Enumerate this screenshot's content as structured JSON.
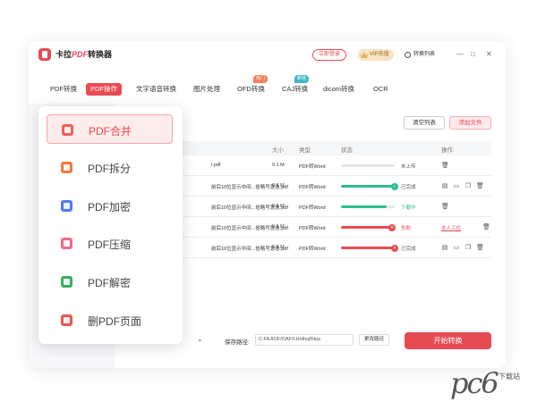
{
  "app": {
    "title_prefix": "卡拉",
    "title_em": "PDF",
    "title_suffix": "转换器",
    "login_label": "立即登录",
    "vip_label": "VIP充值",
    "convert_list_label": "转换列表",
    "colors": {
      "accent": "#e84a54",
      "vip_gold": "#e6b25a",
      "success": "#2bbf8a",
      "error": "#e84a54"
    }
  },
  "nav": {
    "tabs": [
      {
        "label": "PDF转换"
      },
      {
        "label": "PDF操作",
        "active": true
      },
      {
        "label": "文字语音转换"
      },
      {
        "label": "图片处理"
      },
      {
        "label": "OFD转换",
        "badge": "热门"
      },
      {
        "label": "CAJ转换",
        "badge": "新增"
      },
      {
        "label": "dicom转换"
      },
      {
        "label": "OCR"
      }
    ]
  },
  "toolbar": {
    "clear_label": "清空列表",
    "add_label": "添加文件"
  },
  "table": {
    "headers": {
      "size": "大小",
      "type": "类型",
      "status": "状态",
      "ops": "操作"
    },
    "rows": [
      {
        "name": "l.pdf",
        "size": "0.1 M",
        "type": "PDF转Word",
        "progress": 0,
        "status": "未上传",
        "state": "idle"
      },
      {
        "name": "前后10位显示中间...省略号急急.pdf",
        "size": "0.1 M",
        "type": "PDF转Word",
        "progress": 100,
        "status": "已完成",
        "state": "done"
      },
      {
        "name": "前后10位显示中间...省略号急急.pdf",
        "size": "0.1 M",
        "type": "PDF转Word",
        "progress": 85,
        "status": "下载中",
        "state": "downloading"
      },
      {
        "name": "前后10位显示中间...省略号急急.pdf",
        "size": "0.1 M",
        "type": "PDF转Word",
        "progress": 95,
        "status": "失败",
        "state": "failed",
        "op_label": "去人工在"
      },
      {
        "name": "前后10位显示中间...省略号急急.pdf",
        "size": "0.1 M",
        "type": "PDF转Word",
        "progress": 100,
        "status": "已完成",
        "state": "done_red"
      }
    ]
  },
  "bottom": {
    "path_label": "保存路径:",
    "path_value": "C:FAJIOF/OAF/LH/dhsjfhkja",
    "change_label": "更改路径",
    "start_label": "开始转换"
  },
  "popup": {
    "items": [
      {
        "label": "PDF合并",
        "icon": "merge-icon",
        "color": "#f0605f",
        "active": true
      },
      {
        "label": "PDF拆分",
        "icon": "split-icon",
        "color": "#f07a3c"
      },
      {
        "label": "PDF加密",
        "icon": "lock-icon",
        "color": "#4f7cf5"
      },
      {
        "label": "PDF压缩",
        "icon": "compress-icon",
        "color": "#f06a8a"
      },
      {
        "label": "PDF解密",
        "icon": "key-icon",
        "color": "#3bab64"
      },
      {
        "label": "删PDF页面",
        "icon": "scissors-icon",
        "color": "#ef5550"
      }
    ]
  },
  "watermark": {
    "main": "pc6",
    "sub": "下载站"
  }
}
